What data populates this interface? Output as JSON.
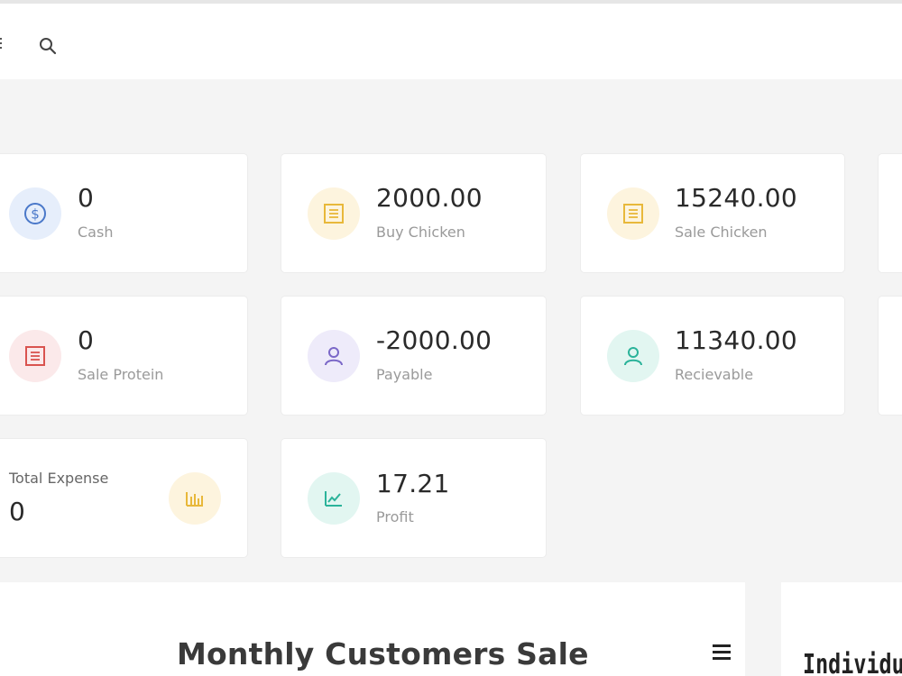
{
  "colors": {
    "page_bg": "#f4f4f4",
    "card_bg": "#ffffff",
    "blue": "#4a78c9",
    "yellow": "#e8b83a",
    "red": "#d9534f",
    "purple": "#7b68c8",
    "teal": "#2bb39a"
  },
  "topbar": {
    "menu_icon": "menu-icon",
    "search_icon": "search-icon"
  },
  "cards": {
    "cash": {
      "value": "0",
      "label": "Cash",
      "icon": "dollar-icon"
    },
    "buy_chicken": {
      "value": "2000.00",
      "label": "Buy Chicken",
      "icon": "list-icon"
    },
    "sale_chicken": {
      "value": "15240.00",
      "label": "Sale Chicken",
      "icon": "list-icon"
    },
    "sale_protein": {
      "value": "0",
      "label": "Sale Protein",
      "icon": "list-icon"
    },
    "payable": {
      "value": "-2000.00",
      "label": "Payable",
      "icon": "user-icon"
    },
    "recievable": {
      "value": "11340.00",
      "label": "Recievable",
      "icon": "user-icon"
    },
    "total_expense": {
      "value": "0",
      "label": "Total Expense",
      "icon": "bar-chart-icon"
    },
    "profit": {
      "value": "17.21",
      "label": "Profit",
      "icon": "line-chart-icon"
    }
  },
  "charts": {
    "monthly_title": "Monthly Customers Sale",
    "individual_title": "Individu"
  }
}
